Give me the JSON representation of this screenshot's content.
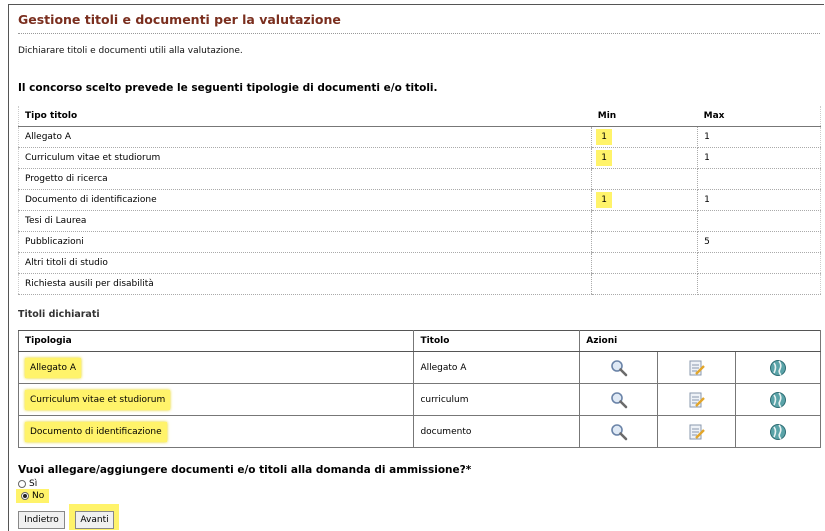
{
  "header": {
    "title": "Gestione titoli e documenti per la valutazione",
    "intro": "Dichiarare titoli e documenti utili alla valutazione."
  },
  "types_section": {
    "heading": "Il concorso scelto prevede le seguenti tipologie di documenti e/o titoli.",
    "columns": {
      "tipo": "Tipo titolo",
      "min": "Min",
      "max": "Max"
    },
    "rows": [
      {
        "tipo": "Allegato A",
        "min": "1",
        "max": "1"
      },
      {
        "tipo": "Curriculum vitae et studiorum",
        "min": "1",
        "max": "1"
      },
      {
        "tipo": "Progetto di ricerca",
        "min": "",
        "max": ""
      },
      {
        "tipo": "Documento di identificazione",
        "min": "1",
        "max": "1"
      },
      {
        "tipo": "Tesi di Laurea",
        "min": "",
        "max": ""
      },
      {
        "tipo": "Pubblicazioni",
        "min": "",
        "max": "5"
      },
      {
        "tipo": "Altri titoli di studio",
        "min": "",
        "max": ""
      },
      {
        "tipo": "Richiesta ausili per disabilità",
        "min": "",
        "max": ""
      }
    ]
  },
  "declared_section": {
    "heading": "Titoli dichiarati",
    "columns": {
      "tipologia": "Tipologia",
      "titolo": "Titolo",
      "azioni": "Azioni"
    },
    "rows": [
      {
        "tipologia": "Allegato A",
        "titolo": "Allegato A"
      },
      {
        "tipologia": "Curriculum vitae et studiorum",
        "titolo": "curriculum"
      },
      {
        "tipologia": "Documento di identificazione",
        "titolo": "documento"
      }
    ],
    "action_icons": [
      "magnifier-icon",
      "edit-document-icon",
      "globe-icon"
    ]
  },
  "question": {
    "text": "Vuoi allegare/aggiungere documenti e/o titoli alla domanda di ammissione?*",
    "options": [
      {
        "label": "Sì",
        "checked": false
      },
      {
        "label": "No",
        "checked": true
      }
    ]
  },
  "buttons": {
    "back": "Indietro",
    "next": "Avanti"
  },
  "colors": {
    "title": "#7a2e1e",
    "highlight": "#fff36a"
  }
}
